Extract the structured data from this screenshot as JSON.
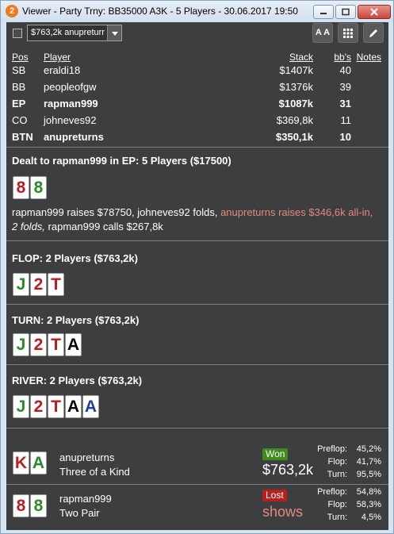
{
  "window": {
    "app_icon": "2",
    "title": "Viewer - Party Trny: BB35000 A3K - 5 Players - 30.06.2017 19:50",
    "minimize_icon": "minimize-icon",
    "maximize_icon": "maximize-icon",
    "close_icon": "close-icon"
  },
  "toolbar": {
    "combo_value": "$763,2k anupreturr",
    "font_button": "A A",
    "grid_icon": "grid-icon",
    "edit_icon": "pencil-icon"
  },
  "players_table": {
    "headers": {
      "pos": "Pos",
      "player": "Player",
      "stack": "Stack",
      "bbs": "bb's",
      "notes": "Notes"
    },
    "rows": [
      {
        "pos": "SB",
        "player": "eraldi18",
        "stack": "$1407k",
        "bbs": "40",
        "bold": false
      },
      {
        "pos": "BB",
        "player": "peopleofgw",
        "stack": "$1376k",
        "bbs": "39",
        "bold": false
      },
      {
        "pos": "EP",
        "player": "rapman999",
        "stack": "$1087k",
        "bbs": "31",
        "bold": true
      },
      {
        "pos": "CO",
        "player": "johneves92",
        "stack": "$369,8k",
        "bbs": "11",
        "bold": false
      },
      {
        "pos": "BTN",
        "player": "anupreturns",
        "stack": "$350,1k",
        "bbs": "10",
        "bold": true
      }
    ]
  },
  "preflop": {
    "title": "Dealt to rapman999 in EP: 5 Players ($17500)",
    "hole_cards": [
      {
        "rank": "8",
        "suit": "hearts",
        "color": "#b51f1f"
      },
      {
        "rank": "8",
        "suit": "clubs",
        "color": "#2a8a2a"
      }
    ],
    "action_part1": "rapman999 raises $78750, johneves92 folds, ",
    "action_allin": "anupreturns raises $346,6k all-in,",
    "action_part2": " 2 folds,",
    "action_part3": " rapman999 calls $267,8k"
  },
  "flop": {
    "title": "FLOP: 2 Players ($763,2k)",
    "cards": [
      {
        "rank": "J",
        "color": "#2a8a2a"
      },
      {
        "rank": "2",
        "color": "#b51f1f"
      },
      {
        "rank": "T",
        "color": "#b51f1f"
      }
    ]
  },
  "turn": {
    "title": "TURN: 2 Players ($763,2k)",
    "cards": [
      {
        "rank": "J",
        "color": "#2a8a2a"
      },
      {
        "rank": "2",
        "color": "#b51f1f"
      },
      {
        "rank": "T",
        "color": "#b51f1f"
      },
      {
        "rank": "A",
        "color": "#000000"
      }
    ]
  },
  "river": {
    "title": "RIVER: 2 Players ($763,2k)",
    "cards": [
      {
        "rank": "J",
        "color": "#2a8a2a"
      },
      {
        "rank": "2",
        "color": "#b51f1f"
      },
      {
        "rank": "T",
        "color": "#b51f1f"
      },
      {
        "rank": "A",
        "color": "#000000"
      },
      {
        "rank": "A",
        "color": "#1e3fa8"
      }
    ]
  },
  "results": [
    {
      "player": "anupreturns",
      "hand": "Three of a Kind",
      "cards": [
        {
          "rank": "K",
          "color": "#b51f1f"
        },
        {
          "rank": "A",
          "color": "#2a8a2a"
        }
      ],
      "status": "Won",
      "amount": "$763,2k",
      "preflop_label": "Preflop:",
      "preflop": "45,2%",
      "flop_label": "Flop:",
      "flop": "41,7%",
      "turn_label": "Turn:",
      "turn": "95,5%"
    },
    {
      "player": "rapman999",
      "hand": "Two Pair",
      "cards": [
        {
          "rank": "8",
          "color": "#b51f1f"
        },
        {
          "rank": "8",
          "color": "#2a8a2a"
        }
      ],
      "status": "Lost",
      "amount": "shows",
      "preflop_label": "Preflop:",
      "preflop": "54,8%",
      "flop_label": "Flop:",
      "flop": "58,3%",
      "turn_label": "Turn:",
      "turn": "4,5%"
    }
  ]
}
